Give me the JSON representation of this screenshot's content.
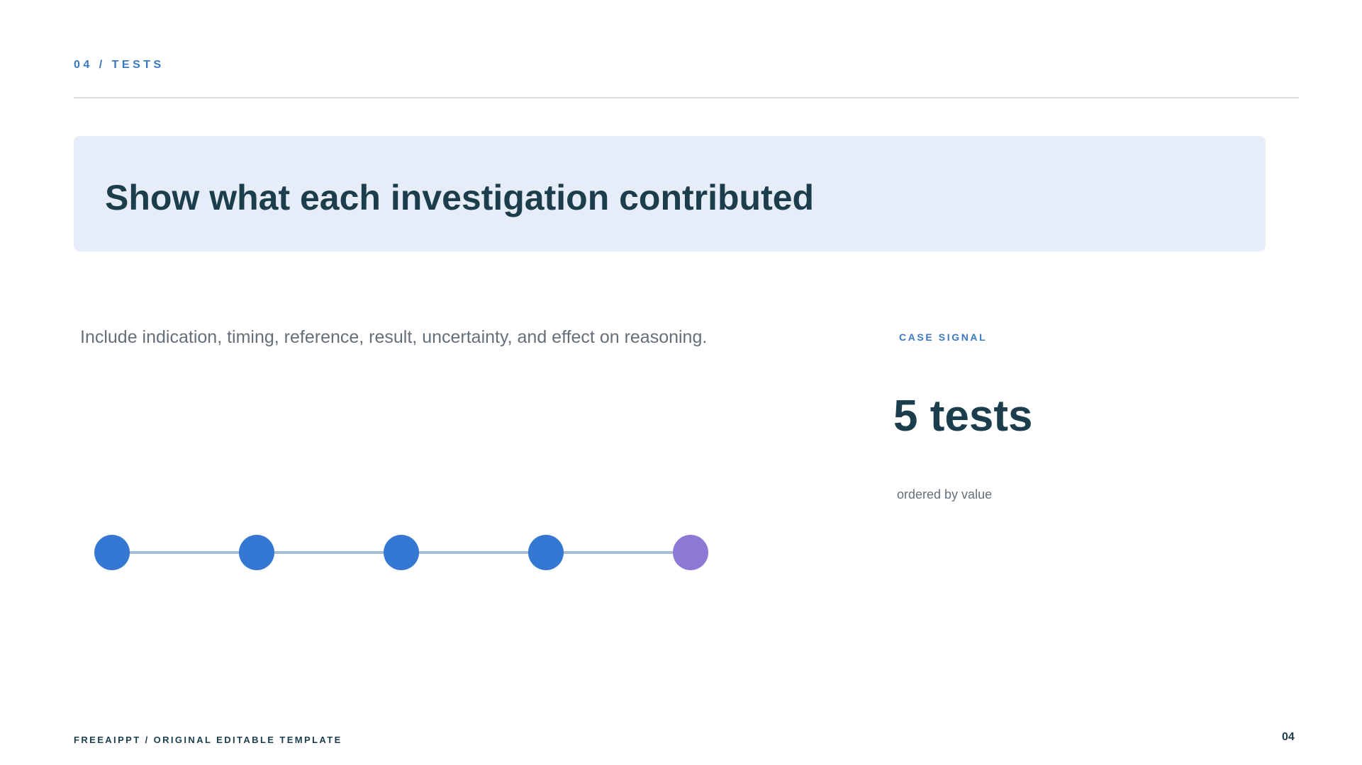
{
  "header": {
    "section_label": "04 / TESTS"
  },
  "title": "Show what each investigation contributed",
  "body": {
    "text": "Include indication, timing, reference, result, uncertainty, and effect on reasoning."
  },
  "signal": {
    "label": "CASE SIGNAL",
    "value": "5 tests",
    "note": "ordered by value"
  },
  "timeline": {
    "nodes": [
      {
        "color": "#3578d4"
      },
      {
        "color": "#3578d4"
      },
      {
        "color": "#3578d4"
      },
      {
        "color": "#3578d4"
      },
      {
        "color": "#8e7ad6"
      }
    ]
  },
  "footer": {
    "left": "FREEAIPPT / ORIGINAL EDITABLE TEMPLATE",
    "page_number": "04"
  }
}
